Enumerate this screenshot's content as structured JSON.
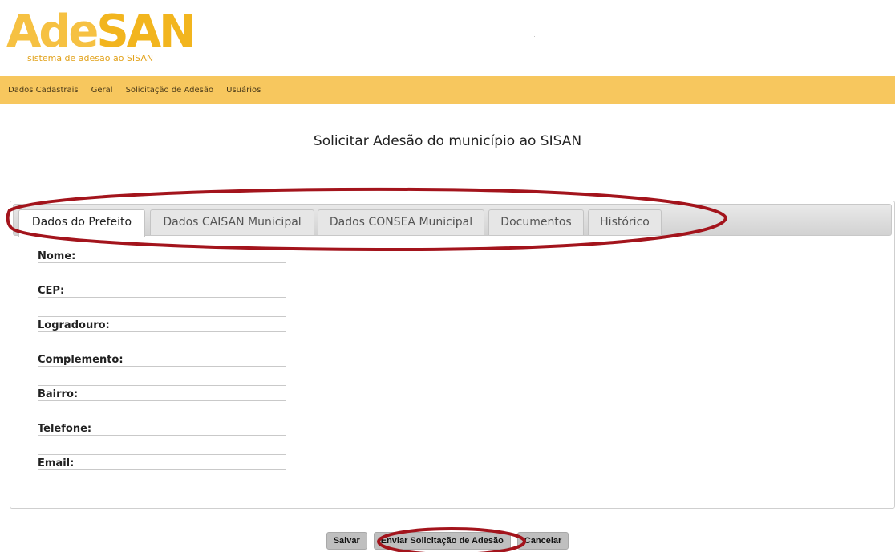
{
  "logo": {
    "wordmark_a": "Ade",
    "wordmark_b": "SAN",
    "tagline": "sistema de adesão ao SISAN"
  },
  "header_mark": "·",
  "menu": {
    "items": [
      {
        "label": "Dados Cadastrais"
      },
      {
        "label": "Geral"
      },
      {
        "label": "Solicitação de Adesão"
      },
      {
        "label": "Usuários"
      }
    ]
  },
  "page": {
    "title": "Solicitar Adesão do município ao SISAN"
  },
  "tabs": [
    {
      "label": "Dados do Prefeito",
      "active": true
    },
    {
      "label": "Dados CAISAN Municipal",
      "active": false
    },
    {
      "label": "Dados CONSEA Municipal",
      "active": false
    },
    {
      "label": "Documentos",
      "active": false
    },
    {
      "label": "Histórico",
      "active": false
    }
  ],
  "form": {
    "fields": [
      {
        "label": "Nome:",
        "value": ""
      },
      {
        "label": "CEP:",
        "value": ""
      },
      {
        "label": "Logradouro:",
        "value": ""
      },
      {
        "label": "Complemento:",
        "value": ""
      },
      {
        "label": "Bairro:",
        "value": ""
      },
      {
        "label": "Telefone:",
        "value": ""
      },
      {
        "label": "Email:",
        "value": ""
      }
    ]
  },
  "buttons": {
    "save": "Salvar",
    "submit": "Enviar Solicitação de Adesão",
    "cancel": "Cancelar"
  },
  "colors": {
    "brand": "#f6c142",
    "menu_bar": "#f7c75e",
    "annotation": "#a3141c"
  }
}
